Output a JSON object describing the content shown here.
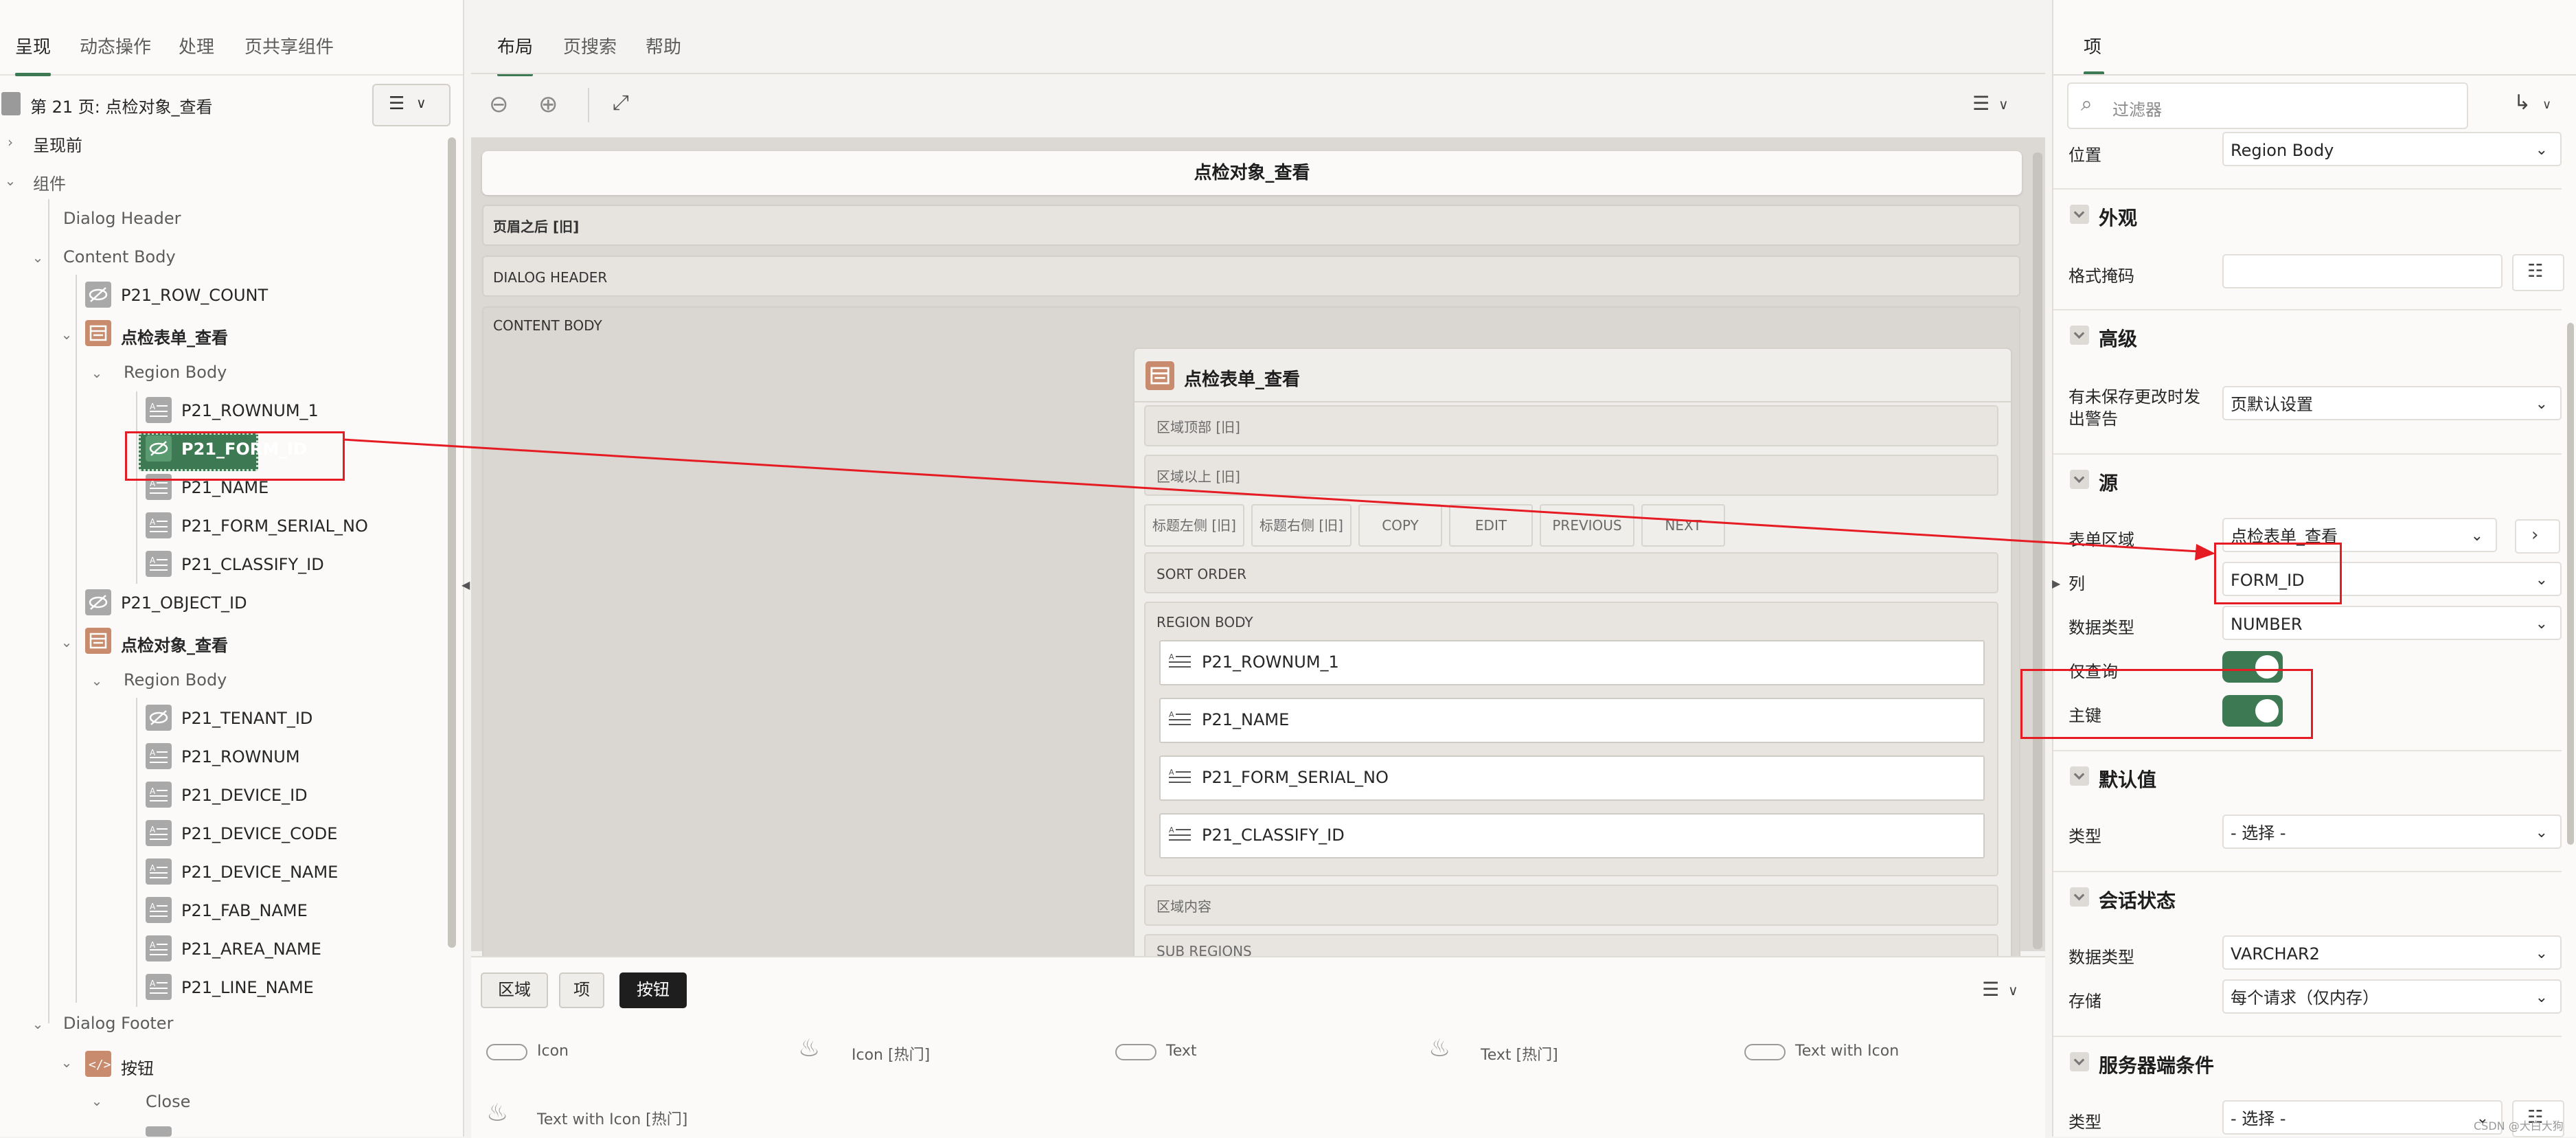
{
  "colors": {
    "accent": "#3d7a53",
    "annotation": "#e51c23"
  },
  "left": {
    "tabs": [
      "呈现",
      "动态操作",
      "处理",
      "页共享组件"
    ],
    "page_title": "第 21 页: 点检对象_查看",
    "tree": {
      "pre_render": "呈现前",
      "components": "组件",
      "dialog_header": "Dialog Header",
      "content_body": "Content Body",
      "row_count": "P21_ROW_COUNT",
      "region1": "点检表单_查看",
      "region1_body": "Region Body",
      "r1_items": [
        "P21_ROWNUM_1",
        "P21_FORM_ID",
        "P21_NAME",
        "P21_FORM_SERIAL_NO",
        "P21_CLASSIFY_ID"
      ],
      "object_id": "P21_OBJECT_ID",
      "region2": "点检对象_查看",
      "region2_body": "Region Body",
      "r2_items": [
        "P21_TENANT_ID",
        "P21_ROWNUM",
        "P21_DEVICE_ID",
        "P21_DEVICE_CODE",
        "P21_DEVICE_NAME",
        "P21_FAB_NAME",
        "P21_AREA_NAME",
        "P21_LINE_NAME"
      ],
      "dialog_footer": "Dialog Footer",
      "buttons": "按钮",
      "close": "Close"
    }
  },
  "center": {
    "tabs": [
      "布局",
      "页搜索",
      "帮助"
    ],
    "page_title": "点检对象_查看",
    "after_header": "页眉之后 [旧]",
    "dialog_header": "DIALOG HEADER",
    "content_body": "CONTENT BODY",
    "region": {
      "title": "点检表单_查看",
      "slot_top": "区域顶部 [旧]",
      "slot_above": "区域以上 [旧]",
      "btn_slots": [
        "标题左侧 [旧]",
        "标题右侧 [旧]",
        "COPY",
        "EDIT",
        "PREVIOUS",
        "NEXT"
      ],
      "sort_order": "SORT ORDER",
      "region_body": "REGION BODY",
      "fields": [
        "P21_ROWNUM_1",
        "P21_NAME",
        "P21_FORM_SERIAL_NO",
        "P21_CLASSIFY_ID"
      ],
      "region_content": "区域内容",
      "sub_regions": "SUB REGIONS"
    },
    "gallery": {
      "tabs": [
        "区域",
        "项",
        "按钮"
      ],
      "items": [
        "Icon",
        "Icon [热门]",
        "Text",
        "Text [热门]",
        "Text with Icon",
        "Text with Icon [热门]"
      ]
    }
  },
  "right": {
    "tab": "项",
    "filter_placeholder": "过滤器",
    "position_label": "位置",
    "position_value": "Region Body",
    "sections": {
      "appearance": "外观",
      "advanced": "高级",
      "source": "源",
      "default": "默认值",
      "session": "会话状态",
      "server_condition": "服务器端条件"
    },
    "format_mask_label": "格式掩码",
    "warn_label_1": "有未保存更改时发",
    "warn_label_2": "出警告",
    "warn_value": "页默认设置",
    "form_region_label": "表单区域",
    "form_region_value": "点检表单_查看",
    "column_label": "列",
    "column_value": "FORM_ID",
    "datatype_label": "数据类型",
    "datatype_value": "NUMBER",
    "query_only_label": "仅查询",
    "primary_key_label": "主键",
    "default_type_label": "类型",
    "default_type_value": "- 选择 -",
    "session_datatype_label": "数据类型",
    "session_datatype_value": "VARCHAR2",
    "storage_label": "存储",
    "storage_value": "每个请求（仅内存）",
    "server_type_label": "类型",
    "server_type_value": "- 选择 -"
  },
  "watermark": "CSDN @大白大狗"
}
